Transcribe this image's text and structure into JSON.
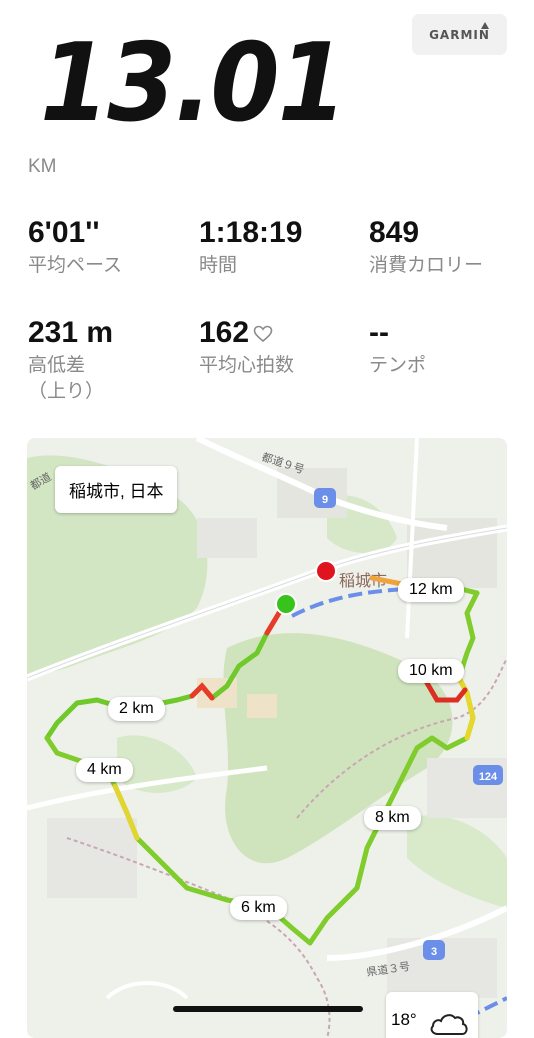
{
  "summary": {
    "distance": "13.01",
    "unit": "KM"
  },
  "brand": {
    "logo_text": "GARMIN"
  },
  "stats": {
    "pace": {
      "value": "6'01''",
      "label": "平均ペース"
    },
    "time": {
      "value": "1:18:19",
      "label": "時間"
    },
    "calories": {
      "value": "849",
      "label": "消費カロリー"
    },
    "elevation": {
      "value": "231 m",
      "label": "高低差",
      "label2": "（上り）"
    },
    "heart_rate": {
      "value": "162",
      "label": "平均心拍数"
    },
    "tempo": {
      "value": "--",
      "label": "テンポ"
    }
  },
  "map": {
    "location_label": "稲城市, 日本",
    "city_name": "稲城市",
    "km_markers": [
      "2 km",
      "4 km",
      "6 km",
      "8 km",
      "10 km",
      "12 km"
    ],
    "road_label": "都道９号",
    "road_label2": "都道",
    "road_label3": "県道３号",
    "route_shields": [
      "9",
      "124",
      "3"
    ],
    "start_color": "#38c21c",
    "end_color": "#e0141e"
  },
  "weather": {
    "temperature": "18°",
    "icon": "cloud-icon"
  }
}
